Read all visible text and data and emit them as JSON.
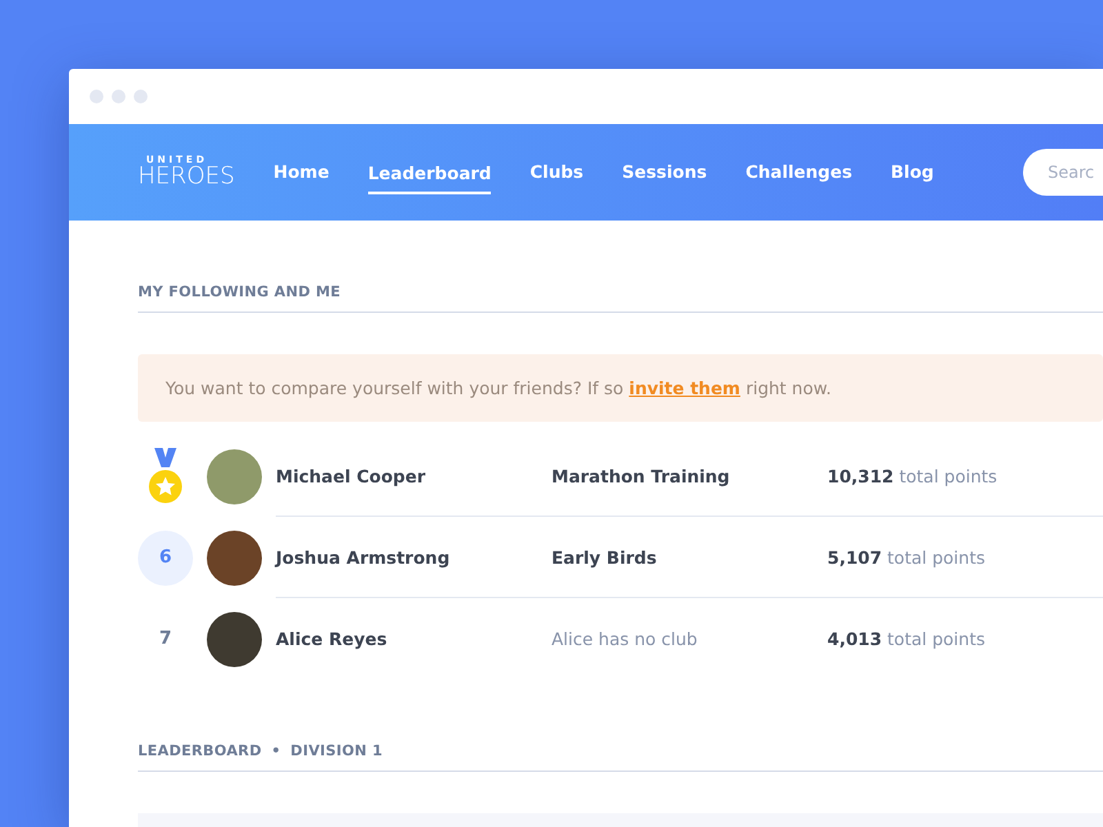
{
  "logo": {
    "top": "UNITED",
    "bottom": "HEROES"
  },
  "nav": [
    {
      "label": "Home",
      "selected": false
    },
    {
      "label": "Leaderboard",
      "selected": true
    },
    {
      "label": "Clubs",
      "selected": false
    },
    {
      "label": "Sessions",
      "selected": false
    },
    {
      "label": "Challenges",
      "selected": false
    },
    {
      "label": "Blog",
      "selected": false
    }
  ],
  "search": {
    "placeholder": "Searc"
  },
  "following": {
    "title": "MY FOLLOWING AND ME",
    "notice": {
      "before": "You want to compare yourself with your friends? If so",
      "link": "invite them",
      "after": "right now."
    },
    "rows": [
      {
        "kind": "medal",
        "selected": false,
        "name": "Michael Cooper",
        "club_muted": false,
        "club": "Marathon Training",
        "points": "10,312",
        "points_label": "total points"
      },
      {
        "kind": "number",
        "rank": "6",
        "selected": true,
        "name": "Joshua Armstrong",
        "club_muted": false,
        "club": "Early Birds",
        "points": "5,107",
        "points_label": "total points"
      },
      {
        "kind": "number",
        "rank": "7",
        "selected": false,
        "name": "Alice Reyes",
        "club_muted": true,
        "club": "Alice has no club",
        "points": "4,013",
        "points_label": "total points"
      }
    ]
  },
  "leaderboard": {
    "title": "LEADERBOARD",
    "separator": "•",
    "division": "DIVISION 1"
  }
}
